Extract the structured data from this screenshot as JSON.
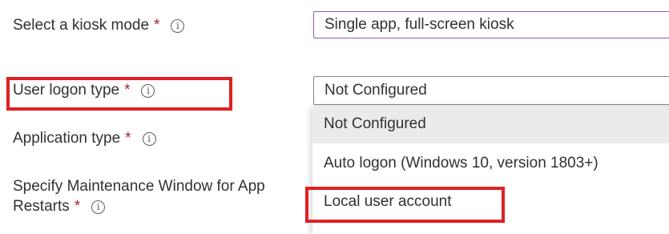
{
  "fields": {
    "kiosk_mode": {
      "label": "Select a kiosk mode",
      "required": "*",
      "value": "Single app, full-screen kiosk"
    },
    "user_logon_type": {
      "label": "User logon type",
      "required": "*",
      "value": "Not Configured"
    },
    "application_type": {
      "label": "Application type",
      "required": "*"
    },
    "maintenance_window": {
      "label_line1": "Specify Maintenance Window for App",
      "label_line2": "Restarts",
      "required": "*"
    }
  },
  "info_icon_glyph": "i",
  "dropdown": {
    "options": [
      {
        "label": "Not Configured",
        "highlighted": true
      },
      {
        "label": "Auto logon (Windows 10, version 1803+)"
      },
      {
        "label": "Local user account"
      }
    ]
  },
  "colors": {
    "required_asterisk": "#a4262c",
    "annotation_box": "#e02020",
    "focused_border": "#8a5db8",
    "option_hover": "#edebe9"
  }
}
